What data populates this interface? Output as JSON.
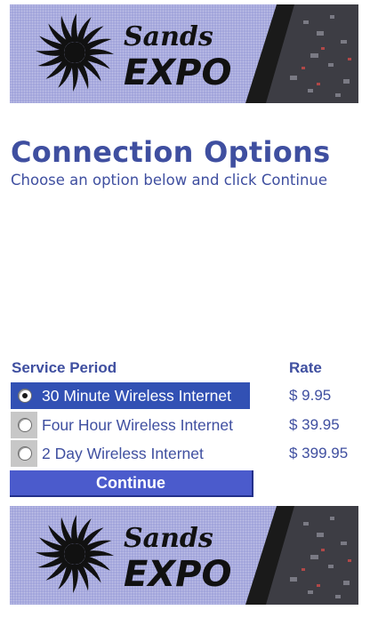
{
  "banner": {
    "logo_word_top": "Sands",
    "logo_word_bottom": "EXPO"
  },
  "header": {
    "title": "Connection Options",
    "subtitle": "Choose an option below and click Continue"
  },
  "table": {
    "col_period": "Service Period",
    "col_rate": "Rate",
    "options": [
      {
        "label": "30 Minute Wireless Internet",
        "rate": "$ 9.95",
        "selected": true
      },
      {
        "label": "Four Hour Wireless Internet",
        "rate": "$ 39.95",
        "selected": false
      },
      {
        "label": "2 Day Wireless Internet",
        "rate": "$ 399.95",
        "selected": false
      }
    ]
  },
  "actions": {
    "continue_label": "Continue"
  },
  "colors": {
    "brand_blue": "#3f4fa0",
    "banner_lavender": "#9b9ed8",
    "selection": "#3251b4",
    "button": "#4b5bcc"
  }
}
